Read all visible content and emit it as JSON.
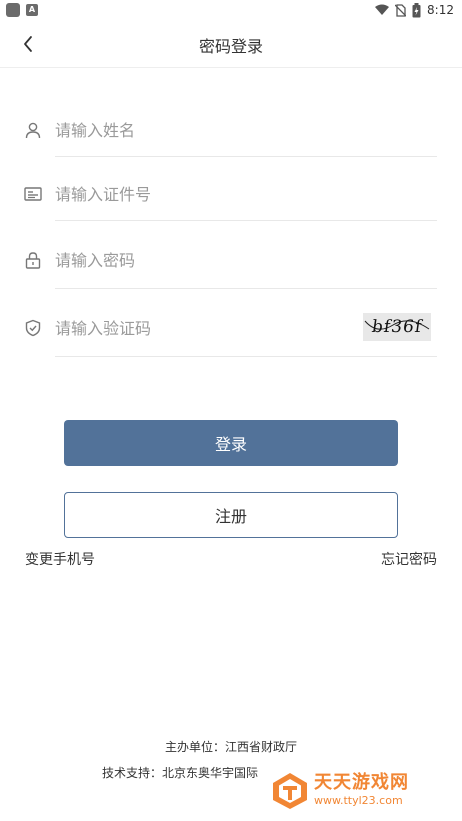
{
  "status_bar": {
    "time": "8:12",
    "notif_icon_1": "app-square-icon",
    "notif_icon_2": "A",
    "icons": [
      "wifi-icon",
      "no-sim-icon",
      "battery-charging-icon"
    ]
  },
  "header": {
    "back_icon": "chevron-left-icon",
    "title": "密码登录"
  },
  "form": {
    "name": {
      "icon": "user-icon",
      "placeholder": "请输入姓名",
      "value": ""
    },
    "id_number": {
      "icon": "id-card-icon",
      "placeholder": "请输入证件号",
      "value": ""
    },
    "password": {
      "icon": "lock-icon",
      "placeholder": "请输入密码",
      "value": ""
    },
    "captcha": {
      "icon": "shield-check-icon",
      "placeholder": "请输入验证码",
      "value": "",
      "image_text": "bf36f"
    }
  },
  "buttons": {
    "login": "登录",
    "register": "注册"
  },
  "links": {
    "change_phone": "变更手机号",
    "forgot_password": "忘记密码"
  },
  "footer": {
    "sponsor": "主办单位：江西省财政厅",
    "tech_support": "技术支持：北京东奥华宇国际"
  },
  "watermark": {
    "title": "天天游戏网",
    "url": "www.ttyl23.com"
  },
  "colors": {
    "primary": "#527299",
    "divider": "#e8e8e8",
    "placeholder": "#9a9a9a",
    "watermark": "#f07a1f"
  }
}
